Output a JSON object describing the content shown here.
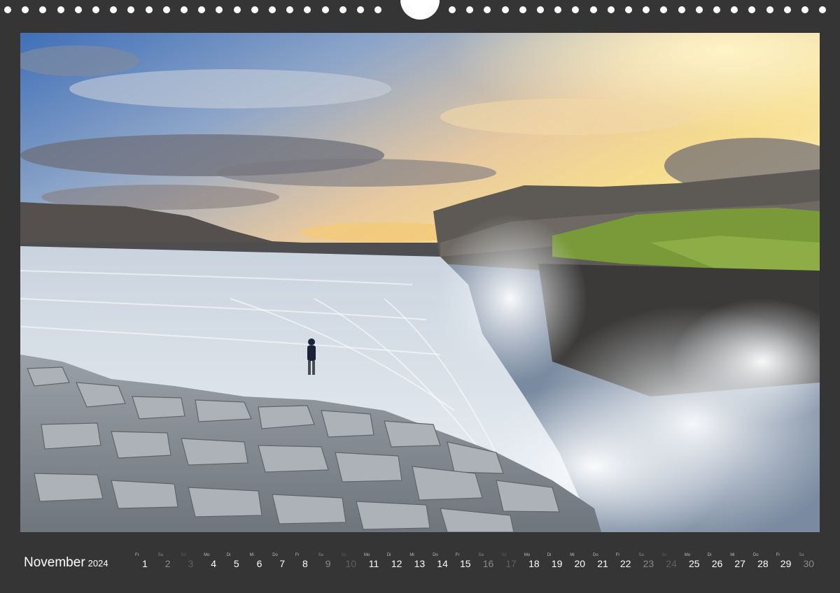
{
  "calendar": {
    "month": "November",
    "year": "2024",
    "days": [
      {
        "wd": "Fr",
        "n": "1"
      },
      {
        "wd": "Sa",
        "n": "2"
      },
      {
        "wd": "So",
        "n": "3"
      },
      {
        "wd": "Mo",
        "n": "4"
      },
      {
        "wd": "Di",
        "n": "5"
      },
      {
        "wd": "Mi",
        "n": "6"
      },
      {
        "wd": "Do",
        "n": "7"
      },
      {
        "wd": "Fr",
        "n": "8"
      },
      {
        "wd": "Sa",
        "n": "9"
      },
      {
        "wd": "So",
        "n": "10"
      },
      {
        "wd": "Mo",
        "n": "11"
      },
      {
        "wd": "Di",
        "n": "12"
      },
      {
        "wd": "Mi",
        "n": "13"
      },
      {
        "wd": "Do",
        "n": "14"
      },
      {
        "wd": "Fr",
        "n": "15"
      },
      {
        "wd": "Sa",
        "n": "16"
      },
      {
        "wd": "So",
        "n": "17"
      },
      {
        "wd": "Mo",
        "n": "18"
      },
      {
        "wd": "Di",
        "n": "19"
      },
      {
        "wd": "Mi",
        "n": "20"
      },
      {
        "wd": "Do",
        "n": "21"
      },
      {
        "wd": "Fr",
        "n": "22"
      },
      {
        "wd": "Sa",
        "n": "23"
      },
      {
        "wd": "So",
        "n": "24"
      },
      {
        "wd": "Mo",
        "n": "25"
      },
      {
        "wd": "Di",
        "n": "26"
      },
      {
        "wd": "Mi",
        "n": "27"
      },
      {
        "wd": "Do",
        "n": "28"
      },
      {
        "wd": "Fr",
        "n": "29"
      },
      {
        "wd": "Sa",
        "n": "30"
      }
    ]
  },
  "colors": {
    "frame": "#353535",
    "weekday_text": "#ffffff",
    "saturday_text": "#8a8a8a",
    "sunday_text": "#5f5f5f"
  }
}
